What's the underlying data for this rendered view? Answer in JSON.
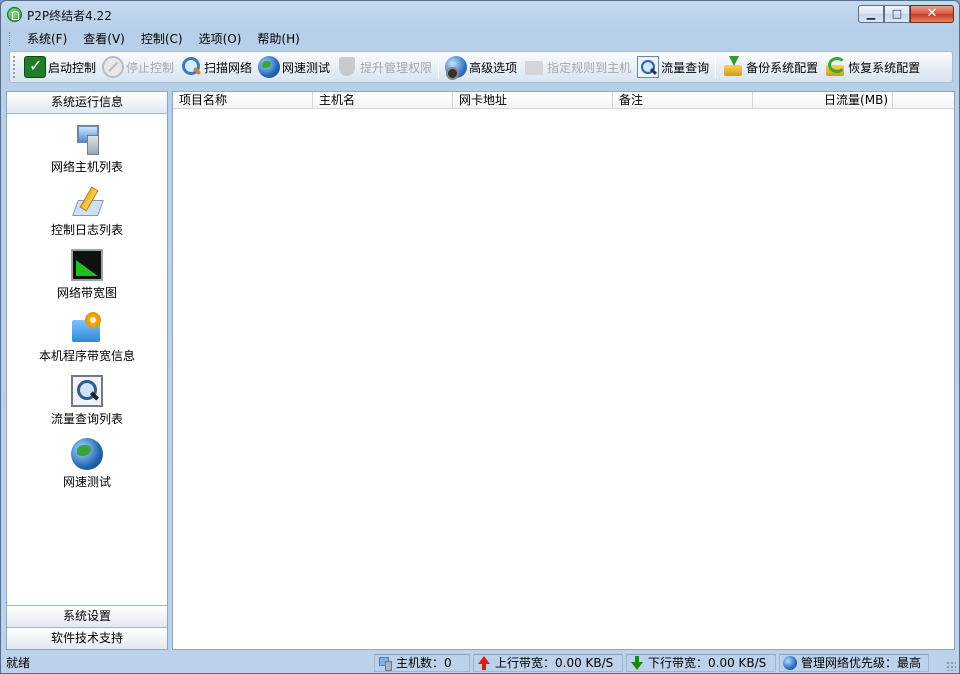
{
  "window": {
    "title": "P2P终结者4.22",
    "minimize_glyph": "▁",
    "maximize_glyph": "□",
    "close_glyph": "✕"
  },
  "menu": {
    "items": [
      "系统(F)",
      "查看(V)",
      "控制(C)",
      "选项(O)",
      "帮助(H)"
    ]
  },
  "toolbar": {
    "start_control": "启动控制",
    "stop_control": "停止控制",
    "scan_network": "扫描网络",
    "speed_test": "网速测试",
    "elevate_admin": "提升管理权限",
    "advanced_options": "高级选项",
    "assign_rules": "指定规则到主机",
    "traffic_query": "流量查询",
    "backup_config": "备份系统配置",
    "restore_config": "恢复系统配置"
  },
  "sidebar": {
    "header": "系统运行信息",
    "items": [
      {
        "label": "网络主机列表",
        "icon": "computer-network-icon"
      },
      {
        "label": "控制日志列表",
        "icon": "log-pen-icon"
      },
      {
        "label": "网络带宽图",
        "icon": "bandwidth-chart-icon"
      },
      {
        "label": "本机程序带宽信息",
        "icon": "program-folder-gear-icon"
      },
      {
        "label": "流量查询列表",
        "icon": "traffic-search-icon"
      },
      {
        "label": "网速测试",
        "icon": "speed-globe-icon"
      }
    ],
    "footer_settings": "系统设置",
    "footer_support": "软件技术支持"
  },
  "listview": {
    "columns": [
      "项目名称",
      "主机名",
      "网卡地址",
      "备注",
      "日流量(MB)"
    ]
  },
  "statusbar": {
    "ready": "就绪",
    "host_count": "主机数：0",
    "upload": "上行带宽：0.00 KB/S",
    "download": "下行带宽：0.00 KB/S",
    "priority": "管理网络优先级：最高"
  }
}
